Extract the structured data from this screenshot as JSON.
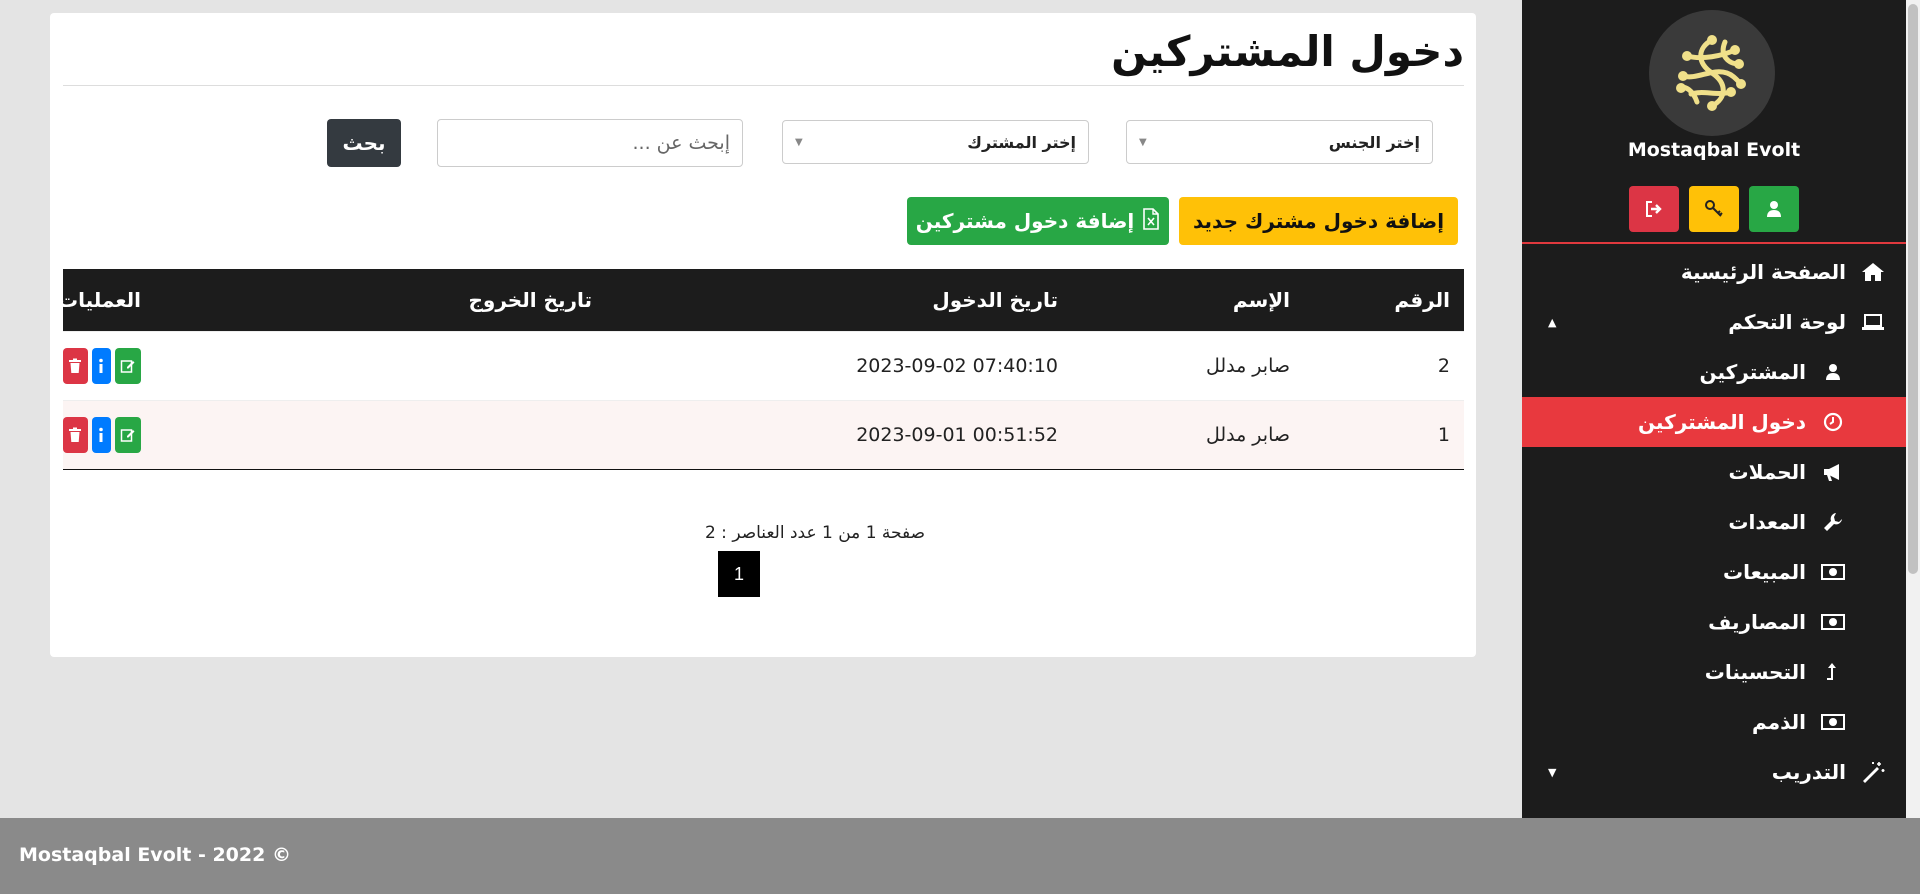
{
  "sidebar": {
    "brand": "Mostaqbal Evolt",
    "buttons": [
      {
        "name": "logout-icon",
        "color": "#dc3545"
      },
      {
        "name": "key-icon",
        "color": "#ffc107"
      },
      {
        "name": "user-icon",
        "color": "#28a745"
      }
    ],
    "items": [
      {
        "label": "الصفحة الرئيسية",
        "icon": "home-icon"
      },
      {
        "label": "لوحة التحكم",
        "icon": "laptop-icon",
        "caret": "▲"
      },
      {
        "label": "المشتركين",
        "icon": "user-icon"
      },
      {
        "label": "دخول المشتركين",
        "icon": "clock-icon"
      },
      {
        "label": "الحملات",
        "icon": "bullhorn-icon"
      },
      {
        "label": "المعدات",
        "icon": "wrench-icon"
      },
      {
        "label": "المبيعات",
        "icon": "money-icon"
      },
      {
        "label": "المصاريف",
        "icon": "money-icon"
      },
      {
        "label": "التحسينات",
        "icon": "level-up-icon"
      },
      {
        "label": "الذمم",
        "icon": "money-icon"
      },
      {
        "label": "التدريب",
        "icon": "magic-icon",
        "caret": "▼"
      }
    ]
  },
  "page": {
    "title": "دخول المشتركين"
  },
  "filters": {
    "gender_select": "إختر الجنس",
    "subscriber_select": "إختر المشترك",
    "search_placeholder": "إبحث عن ...",
    "search_button": "بحث"
  },
  "actions": {
    "add_entry": "إضافة دخول مشترك جديد",
    "add_subscribers_excel": "إضافة دخول مشتركين"
  },
  "table": {
    "headers": {
      "number": "الرقم",
      "name": "الإسم",
      "entry_date": "تاريخ الدخول",
      "exit_date": "تاريخ الخروج",
      "operations": "العمليات"
    },
    "rows": [
      {
        "number": "2",
        "name": "صابر مدلل",
        "entry_date": "2023-09-02 07:40:10",
        "exit_date": ""
      },
      {
        "number": "1",
        "name": "صابر مدلل",
        "entry_date": "2023-09-01 00:51:52",
        "exit_date": ""
      }
    ]
  },
  "pagination": {
    "summary": "صفحة 1 من 1 عدد العناصر : 2",
    "current_page": "1"
  },
  "footer": {
    "text": "Mostaqbal Evolt - 2022 ©"
  },
  "colors": {
    "sidebar_bg": "#1c1c1c",
    "active_item": "#e8393e",
    "warning": "#ffc107",
    "success": "#28a745",
    "danger": "#dc3545",
    "info": "#007bff"
  }
}
